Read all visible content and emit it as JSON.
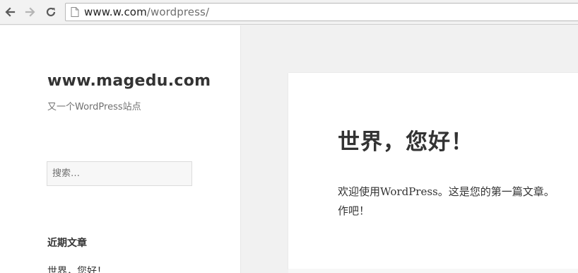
{
  "browser": {
    "url_host": "www.w.com",
    "url_path": "/wordpress/",
    "icons": {
      "back": "arrow-left-icon",
      "forward": "arrow-right-icon",
      "reload": "reload-icon",
      "page": "page-icon"
    }
  },
  "site": {
    "title": "www.magedu.com",
    "description": "又一个WordPress站点"
  },
  "search": {
    "placeholder": "搜索…"
  },
  "recent_posts": {
    "heading": "近期文章",
    "items": [
      "世界，您好！"
    ]
  },
  "post": {
    "title": "世界，您好！",
    "content_line_1": "欢迎使用WordPress。这是您的第一篇文章。",
    "content_line_2": "作吧！"
  }
}
